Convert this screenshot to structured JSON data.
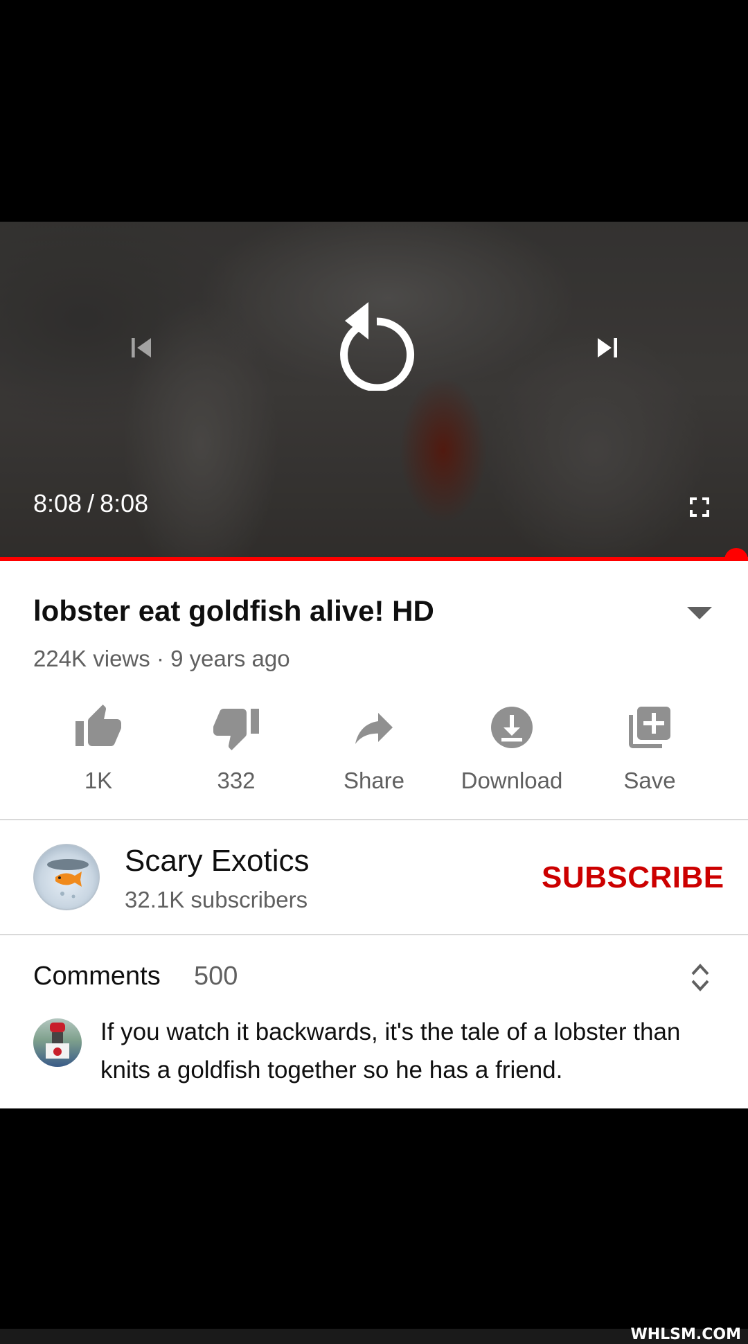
{
  "player": {
    "current_time": "8:08",
    "separator": "/",
    "duration": "8:08",
    "progress_fraction": 1.0,
    "icons": {
      "previous": "skip-previous-icon",
      "replay": "replay-icon",
      "next": "skip-next-icon",
      "fullscreen": "fullscreen-icon"
    }
  },
  "video": {
    "title": "lobster eat goldfish alive! HD",
    "views": "224K views",
    "dot": "·",
    "age": "9 years ago"
  },
  "actions": [
    {
      "label": "1K",
      "icon": "thumbs-up-icon"
    },
    {
      "label": "332",
      "icon": "thumbs-down-icon"
    },
    {
      "label": "Share",
      "icon": "share-icon"
    },
    {
      "label": "Download",
      "icon": "download-icon"
    },
    {
      "label": "Save",
      "icon": "playlist-add-icon"
    }
  ],
  "channel": {
    "name": "Scary Exotics",
    "subscribers": "32.1K subscribers",
    "subscribe_label": "SUBSCRIBE"
  },
  "comments": {
    "label": "Comments",
    "count": "500",
    "top_comment": "If you watch it backwards, it's the tale of a lobster than knits a goldfish together so he has a friend."
  },
  "watermark": "WHLSM.COM",
  "colors": {
    "accent": "#ff0000",
    "subscribe": "#cc0000",
    "secondary_text": "#606060",
    "icon_gray": "#909090"
  }
}
